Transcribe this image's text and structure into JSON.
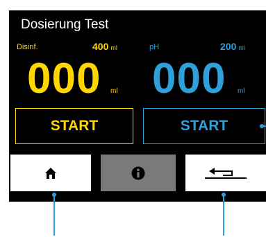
{
  "colors": {
    "background": "#000000",
    "disinfection": "#ffd600",
    "ph": "#2ea0da",
    "nav_button": "#ffffff",
    "nav_button_inactive": "#7a7a7a",
    "callout": "#2ea0da"
  },
  "header": {
    "title": "Dosierung Test"
  },
  "disinfection": {
    "label": "Disinf.",
    "target_amount": "400",
    "target_unit": "ml",
    "dosed_value": "000",
    "dosed_unit": "ml",
    "start_label": "START"
  },
  "ph": {
    "label": "pH",
    "target_amount": "200",
    "target_unit": "ml",
    "dosed_value": "000",
    "dosed_unit": "ml",
    "start_label": "START"
  },
  "nav": {
    "home_icon": "home-icon",
    "info_icon": "info-icon",
    "back_icon": "return-arrow-icon"
  }
}
